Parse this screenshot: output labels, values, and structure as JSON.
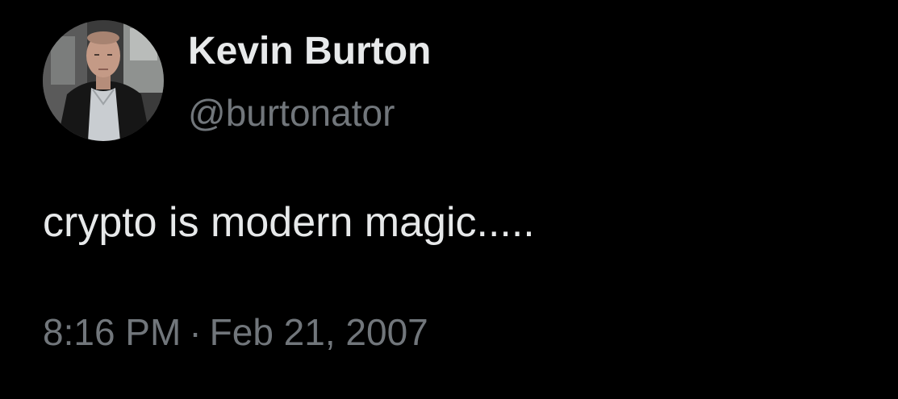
{
  "tweet": {
    "author": {
      "display_name": "Kevin Burton",
      "handle": "@burtonator"
    },
    "text": "crypto is modern magic.....",
    "time": "8:16 PM",
    "separator": "·",
    "date": "Feb 21, 2007"
  },
  "colors": {
    "background": "#000000",
    "primary_text": "#e7e9ea",
    "secondary_text": "#71767b"
  }
}
